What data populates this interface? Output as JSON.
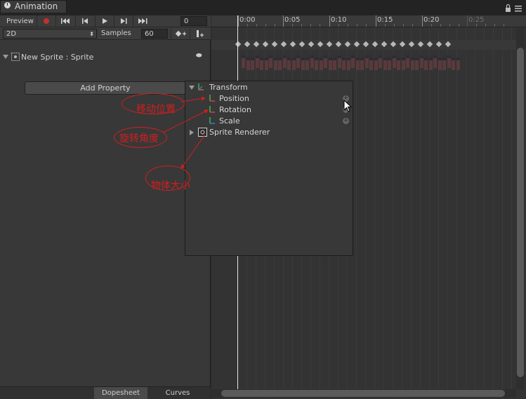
{
  "window": {
    "tab_title": "Animation"
  },
  "toolbar": {
    "preview_label": "Preview",
    "frame_value": "0",
    "mode_value": "2D",
    "samples_label": "Samples",
    "samples_value": "60"
  },
  "ruler": {
    "ticks": [
      "0:00",
      "0:05",
      "0:10",
      "0:15",
      "0:20",
      "0:25"
    ]
  },
  "clip": {
    "object_label": "New Sprite : Sprite"
  },
  "add_property": {
    "label": "Add Property"
  },
  "popup": {
    "transform_label": "Transform",
    "position_label": "Position",
    "rotation_label": "Rotation",
    "scale_label": "Scale",
    "sprite_renderer_label": "Sprite Renderer"
  },
  "annotations": {
    "position_note": "移动位置",
    "rotation_note": "旋转角度",
    "scale_note": "物体大小",
    "color": "#d21e1e"
  },
  "bottom_tabs": {
    "dopesheet": "Dopesheet",
    "curves": "Curves"
  },
  "icons": [
    "clock-icon",
    "record-icon",
    "first-key-icon",
    "prev-key-icon",
    "play-icon",
    "next-key-icon",
    "last-key-icon",
    "add-keyframe-icon",
    "add-event-icon",
    "lock-icon",
    "menu-icon",
    "foldout-arrow-icon",
    "sprite-icon",
    "transform-axis-icon",
    "sprite-renderer-icon",
    "plus-icon",
    "cursor-icon"
  ]
}
